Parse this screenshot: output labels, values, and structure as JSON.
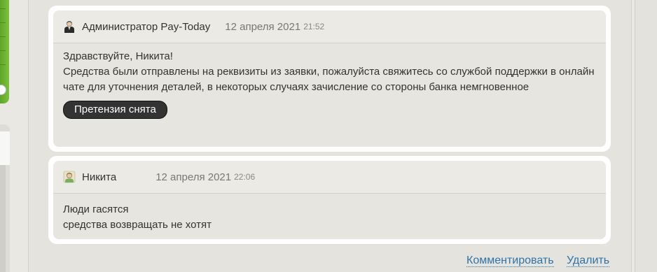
{
  "comments": [
    {
      "author": "Администратор Pay-Today",
      "avatar_icon": "admin-avatar-icon",
      "date": "12 апреля 2021",
      "time": "21:52",
      "lines": [
        "Здравствуйте, Никита!",
        "Средства были отправлены на реквизиты из заявки, пожалуйста свяжитесь со службой поддержки в онлайн чате для уточнения деталей, в некоторых случаях зачисление со стороны банка немгновенное"
      ],
      "status_badge": "Претензия снята"
    },
    {
      "author": "Никита",
      "avatar_icon": "user-avatar-icon",
      "date": "12 апреля 2021",
      "time": "22:06",
      "lines": [
        "Люди гасятся",
        "средства возвращать не хотят"
      ]
    }
  ],
  "actions": {
    "comment": "Комментировать",
    "delete": "Удалить"
  },
  "colors": {
    "accent_green": "#6db533",
    "link_blue": "#2e74a8",
    "badge_dark": "#333333"
  }
}
